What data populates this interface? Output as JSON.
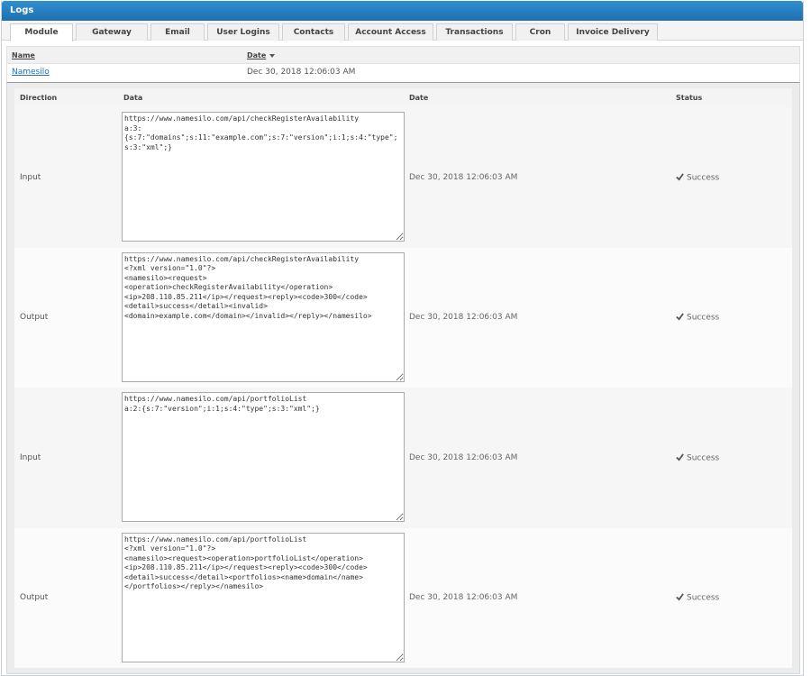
{
  "header": {
    "title": "Logs"
  },
  "tabs": [
    {
      "label": "Module",
      "width": 70
    },
    {
      "label": "Gateway",
      "width": 80
    },
    {
      "label": "Email",
      "width": 60
    },
    {
      "label": "User Logins",
      "width": 80
    },
    {
      "label": "Contacts",
      "width": 70
    },
    {
      "label": "Account Access",
      "width": 95
    },
    {
      "label": "Transactions",
      "width": 85
    },
    {
      "label": "Cron",
      "width": 55
    },
    {
      "label": "Invoice Delivery",
      "width": 100
    }
  ],
  "outer_table": {
    "headers": {
      "name": "Name",
      "date": "Date"
    },
    "row": {
      "name": "Namesilo",
      "date": "Dec 30, 2018 12:06:03 AM"
    }
  },
  "detail_table": {
    "headers": {
      "direction": "Direction",
      "data": "Data",
      "date": "Date",
      "status": "Status"
    },
    "rows": [
      {
        "direction": "Input",
        "data": "https://www.namesilo.com/api/checkRegisterAvailability\na:3:\n{s:7:\"domains\";s:11:\"example.com\";s:7:\"version\";i:1;s:4:\"type\";s:3:\"xml\";}",
        "date": "Dec 30, 2018 12:06:03 AM",
        "status": "Success"
      },
      {
        "direction": "Output",
        "data": "https://www.namesilo.com/api/checkRegisterAvailability\n<?xml version=\"1.0\"?>\n<namesilo><request>\n<operation>checkRegisterAvailability</operation>\n<ip>208.110.85.211</ip></request><reply><code>300</code>\n<detail>success</detail><invalid>\n<domain>example.com</domain></invalid></reply></namesilo>",
        "date": "Dec 30, 2018 12:06:03 AM",
        "status": "Success"
      },
      {
        "direction": "Input",
        "data": "https://www.namesilo.com/api/portfolioList\na:2:{s:7:\"version\";i:1;s:4:\"type\";s:3:\"xml\";}",
        "date": "Dec 30, 2018 12:06:03 AM",
        "status": "Success"
      },
      {
        "direction": "Output",
        "data": "https://www.namesilo.com/api/portfolioList\n<?xml version=\"1.0\"?>\n<namesilo><request><operation>portfolioList</operation>\n<ip>208.110.85.211</ip></request><reply><code>300</code>\n<detail>success</detail><portfolios><name>domain</name>\n</portfolios></reply></namesilo>",
        "date": "Dec 30, 2018 12:06:03 AM",
        "status": "Success"
      }
    ]
  },
  "icons": {
    "status": "check-icon",
    "sort": "sort-desc-icon"
  },
  "colors": {
    "header_blue": "#1e6fb0",
    "link": "#1e73be"
  }
}
